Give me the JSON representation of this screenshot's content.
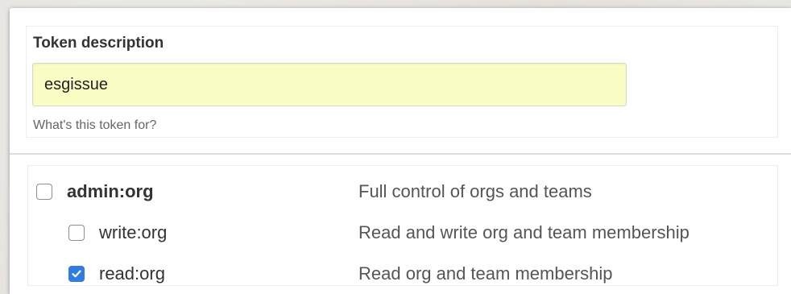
{
  "token_description": {
    "title": "Token description",
    "value": "esgissue",
    "hint": "What's this token for?"
  },
  "scopes": [
    {
      "name": "admin:org",
      "description": "Full control of orgs and teams",
      "checked": false,
      "bold": true
    },
    {
      "name": "write:org",
      "description": "Read and write org and team membership",
      "checked": false,
      "bold": false
    },
    {
      "name": "read:org",
      "description": "Read org and team membership",
      "checked": true,
      "bold": false
    }
  ],
  "colors": {
    "input_background": "#fafdc3",
    "checkbox_checked": "#2f7de1"
  }
}
